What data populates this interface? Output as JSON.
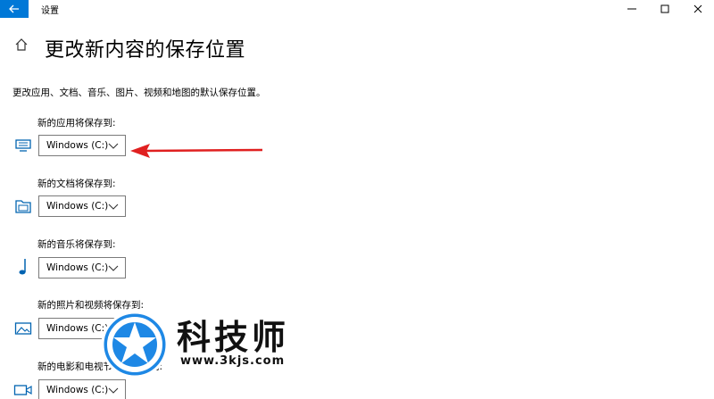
{
  "window": {
    "title": "设置",
    "back_icon": "back-arrow-icon",
    "minimize_icon": "minimize-icon",
    "maximize_icon": "maximize-icon",
    "close_icon": "close-icon"
  },
  "header": {
    "home_icon": "home-icon",
    "title": "更改新内容的保存位置"
  },
  "description": "更改应用、文档、音乐、图片、视频和地图的默认保存位置。",
  "sections": [
    {
      "label": "新的应用将保存到:",
      "icon": "monitor-icon",
      "selected": "Windows (C:)"
    },
    {
      "label": "新的文档将保存到:",
      "icon": "folder-icon",
      "selected": "Windows (C:)"
    },
    {
      "label": "新的音乐将保存到:",
      "icon": "music-note-icon",
      "selected": "Windows (C:)"
    },
    {
      "label": "新的照片和视频将保存到:",
      "icon": "picture-icon",
      "selected": "Windows (C:)"
    },
    {
      "label": "新的电影和电视节目将保存到:",
      "icon": "camera-icon",
      "selected": "Windows (C:)"
    }
  ],
  "annotation_arrow_color": "#e02020",
  "accent_color": "#0078d7",
  "watermark": {
    "name": "科技师",
    "url": "www.3kjs.com",
    "logo_color": "#1e88e5"
  }
}
